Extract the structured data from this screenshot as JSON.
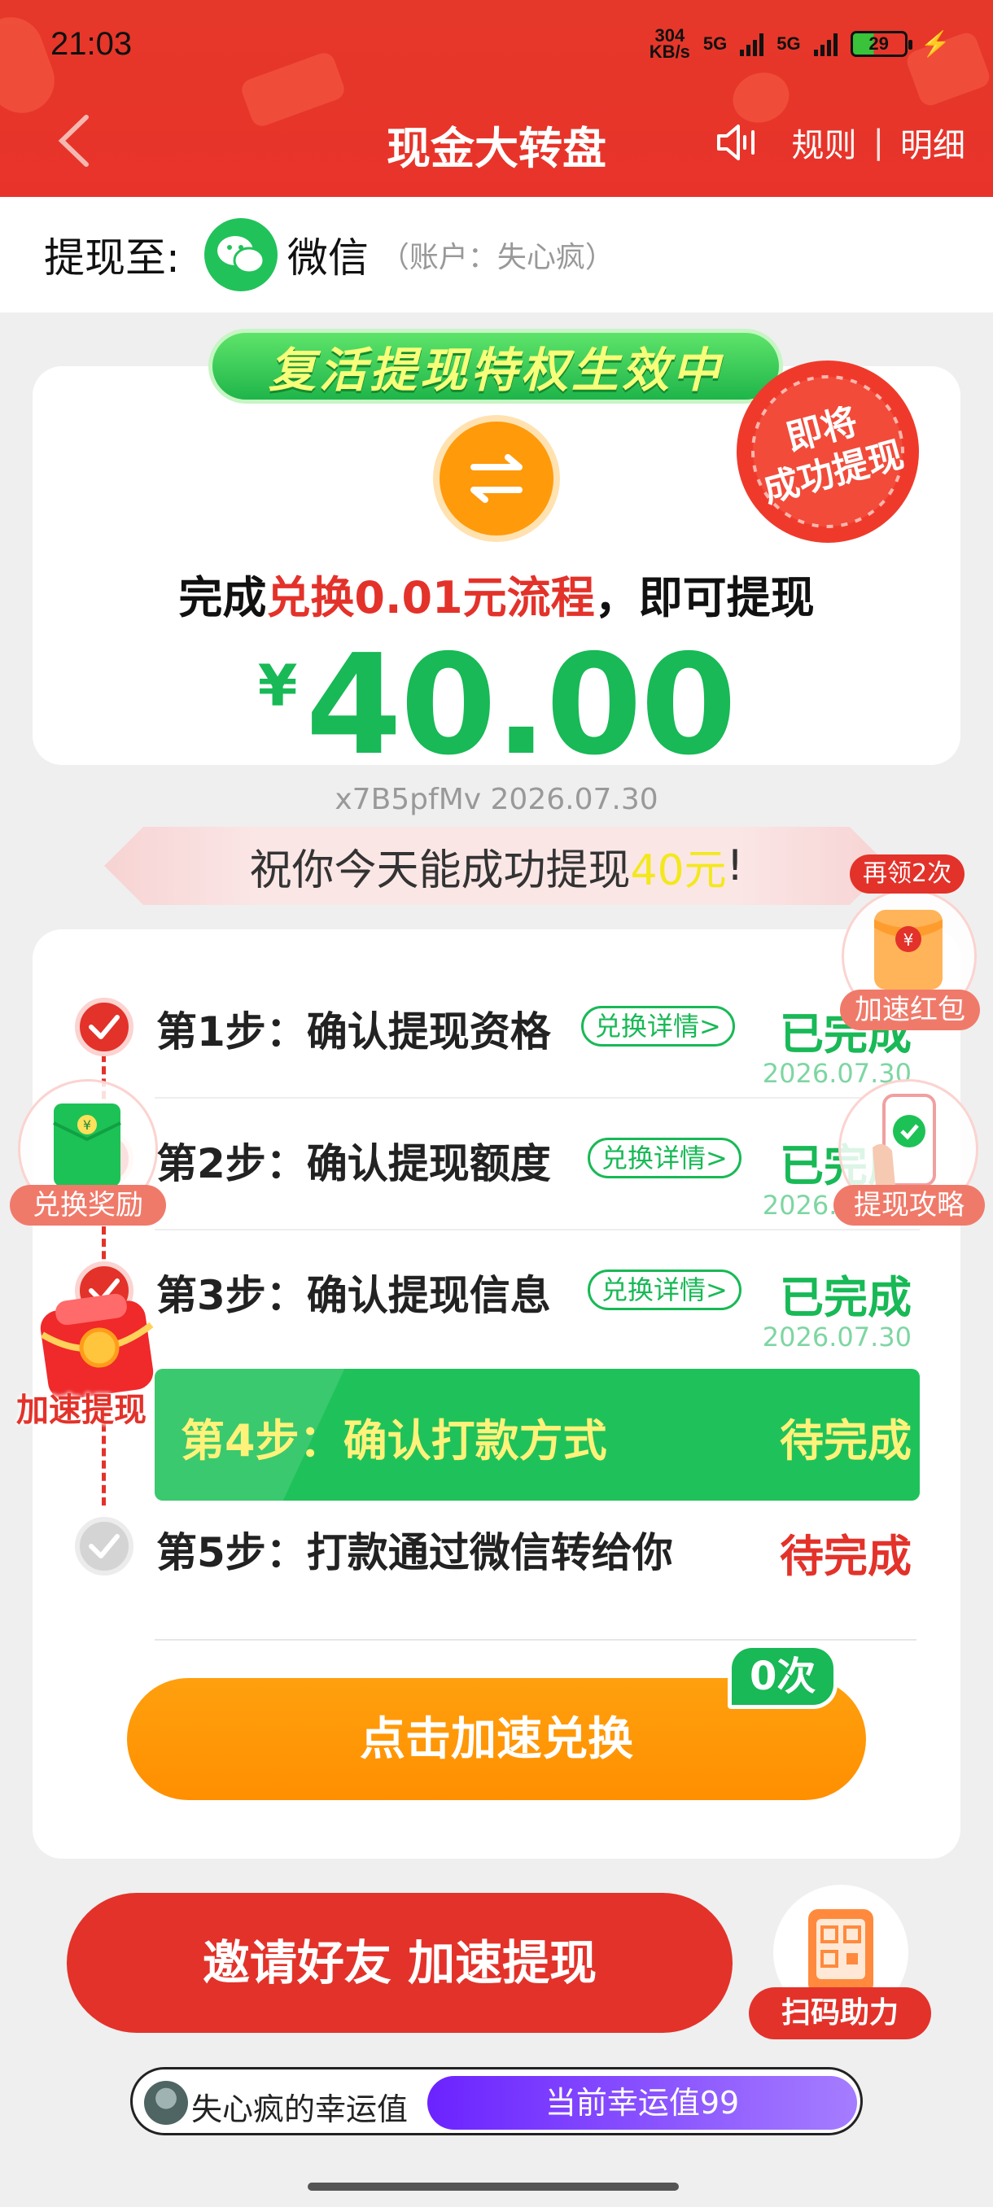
{
  "status": {
    "time": "21:03",
    "net_speed": "304\nKB/s",
    "net_speed_top": "304",
    "net_speed_bottom": "KB/s",
    "sim1": "5G",
    "sim2": "5G",
    "battery": "29"
  },
  "nav": {
    "title": "现金大转盘",
    "rules_label": "规则",
    "separator": "|",
    "details_label": "明细"
  },
  "withdraw": {
    "label": "提现至:",
    "method": "微信",
    "account": "（账户：失心疯）"
  },
  "hero": {
    "banner": "复活提现特权生效中",
    "seal_line1": "即将",
    "seal_line2": "成功提现",
    "complete_prefix": "完成",
    "complete_highlight": "兑换0.01元流程",
    "complete_suffix": "，即可提现",
    "currency": "¥",
    "amount": "40.00"
  },
  "code_line": "x7B5pfMv 2026.07.30",
  "wish": {
    "prefix": "祝你今天能成功提现",
    "highlight": "40元",
    "suffix": "!"
  },
  "steps": [
    {
      "title": "第1步：确认提现资格",
      "pill": "兑换详情>",
      "status": "已完成",
      "date": "2026.07.30"
    },
    {
      "title": "第2步：确认提现额度",
      "pill": "兑换详情>",
      "status": "已完成",
      "date": "2026.07.30"
    },
    {
      "title": "第3步：确认提现信息",
      "pill": "兑换详情>",
      "status": "已完成",
      "date": "2026.07.30"
    },
    {
      "title": "第4步：确认打款方式",
      "status": "待完成"
    },
    {
      "title": "第5步：打款通过微信转给你",
      "status": "待完成"
    }
  ],
  "speed_button": "点击加速兑换",
  "speed_count": "0次",
  "invite_button": "邀请好友 加速提现",
  "scan_label": "扫码助力",
  "lucky": {
    "owner": "失心疯的幸运值",
    "value": "当前幸运值99"
  },
  "floats": {
    "redpack_badge": "再领2次",
    "redpack_label": "加速红包",
    "exchange_label": "兑换奖励",
    "guide_label": "提现攻略",
    "speed_label": "加速提现"
  },
  "colors": {
    "brand_red": "#e3322a",
    "green": "#18b956",
    "orange": "#ff9a0b",
    "purple": "#6b23ff"
  }
}
